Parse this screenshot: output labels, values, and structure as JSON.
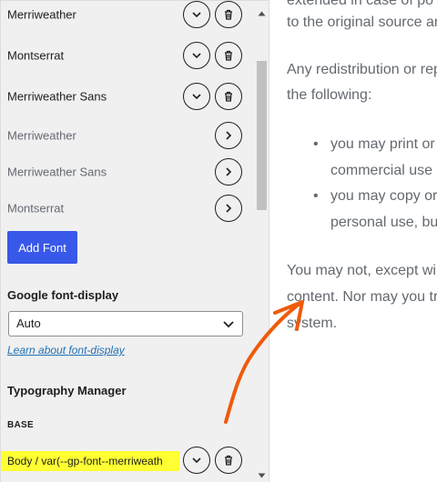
{
  "fonts": [
    {
      "name": "Merriweather",
      "expand": true,
      "delete": true,
      "muted": false
    },
    {
      "name": "Montserrat",
      "expand": true,
      "delete": true,
      "muted": false
    },
    {
      "name": "Merriweather Sans",
      "expand": true,
      "delete": true,
      "muted": false
    },
    {
      "name": "Merriweather",
      "open": true,
      "muted": true
    },
    {
      "name": "Merriweather Sans",
      "open": true,
      "muted": true
    },
    {
      "name": "Montserrat",
      "open": true,
      "muted": true
    }
  ],
  "add_font_label": "Add Font",
  "google_font_display": {
    "label": "Google font-display",
    "selected": "Auto",
    "learn_link": "Learn about font-display"
  },
  "typography_manager": {
    "title": "Typography Manager",
    "base_label": "BASE",
    "body_row": "Body / var(--gp-font--merriweath"
  },
  "article": {
    "lines": [
      "to the original source an",
      "Any redistribution or rep",
      "the following:",
      "you may print or",
      "commercial use",
      "you may copy or",
      "personal use, bu",
      "You may not, except wi",
      "content. Nor may you tr",
      "system."
    ],
    "clipped_top": "extended in case of po"
  },
  "colors": {
    "accent": "#3858e9",
    "highlight": "#ffff33",
    "annotation": "#f05a0a",
    "link": "#2271b1"
  }
}
